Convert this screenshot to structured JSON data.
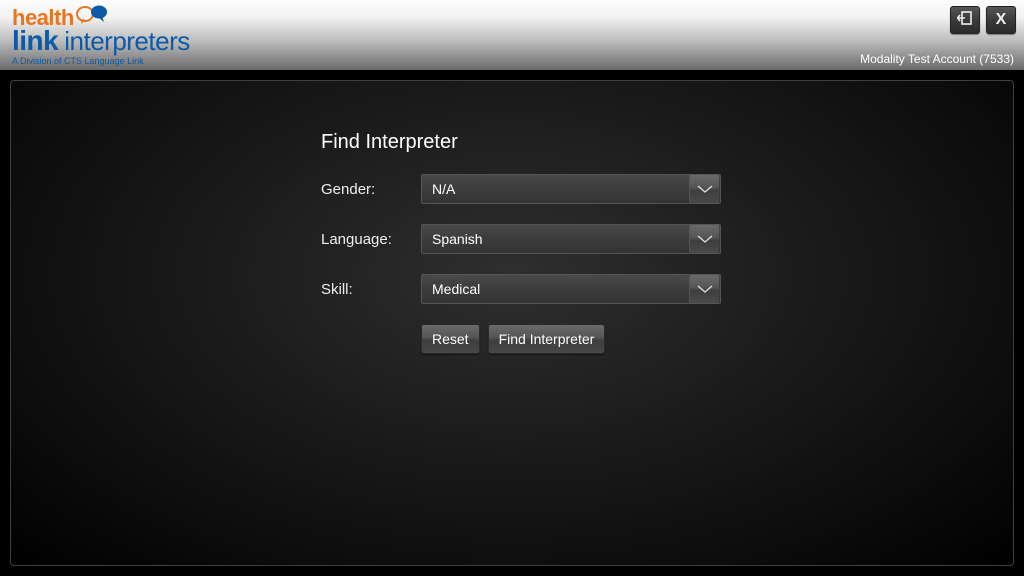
{
  "header": {
    "logo": {
      "word1": "health",
      "word2": "link",
      "word3": "interpreters",
      "tagline": "A Division of CTS Language Link"
    },
    "account_label": "Modality Test Account (7533)",
    "close_label": "X"
  },
  "form": {
    "title": "Find Interpreter",
    "gender_label": "Gender:",
    "gender_value": "N/A",
    "language_label": "Language:",
    "language_value": "Spanish",
    "skill_label": "Skill:",
    "skill_value": "Medical",
    "reset_label": "Reset",
    "submit_label": "Find Interpreter"
  }
}
